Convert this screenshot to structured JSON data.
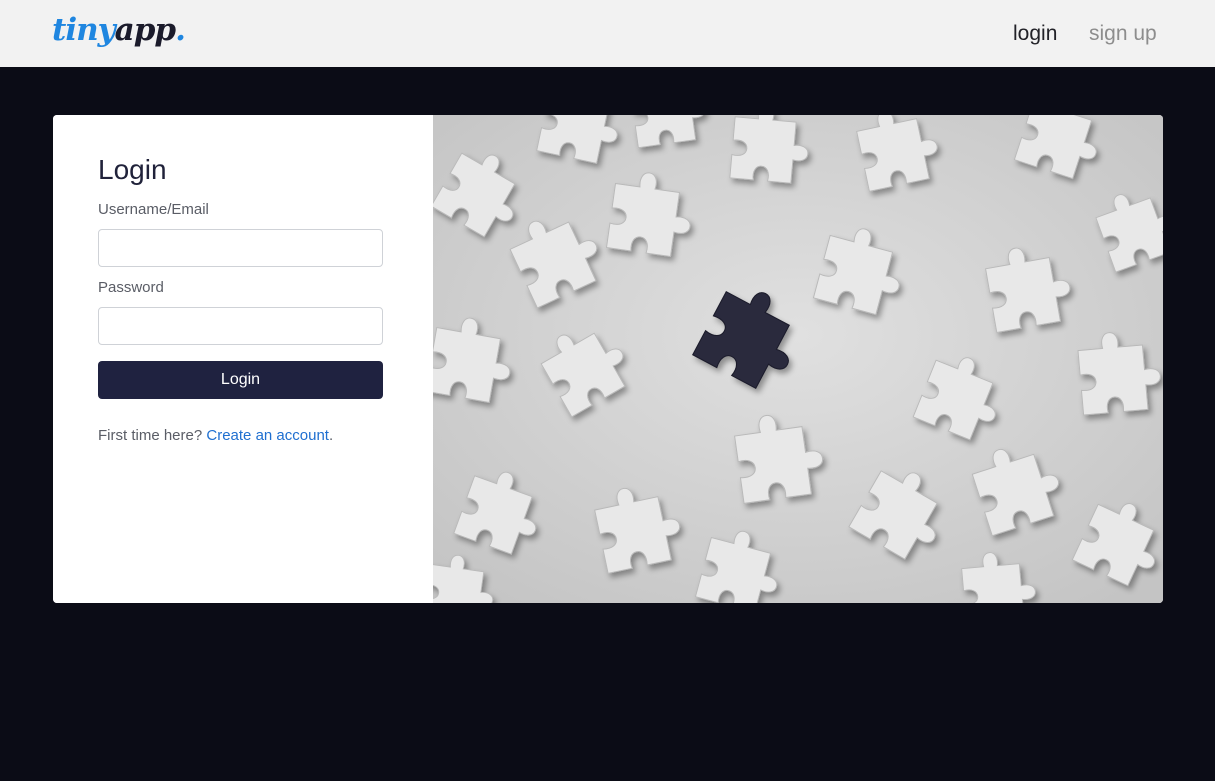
{
  "navbar": {
    "brand": {
      "part1": "tiny",
      "part2": "app",
      "part3": "."
    },
    "links": {
      "login": "login",
      "signup": "sign up"
    }
  },
  "login_form": {
    "title": "Login",
    "username_label": "Username/Email",
    "username_value": "",
    "password_label": "Password",
    "password_value": "",
    "submit_label": "Login",
    "first_time_text": "First time here? ",
    "create_account_link": "Create an account",
    "trailing_period": "."
  },
  "image": {
    "description_icon": "puzzle-pieces-image",
    "colors": {
      "background": "#d4d4d4",
      "piece": "#e9e9e9",
      "highlight_piece": "#2a2a3e"
    }
  },
  "colors": {
    "page_bg": "#0b0c16",
    "navbar_bg": "#f2f2f2",
    "brand_blue": "#1f86e0",
    "button_bg": "#1f2240",
    "link_blue": "#1f6fd0"
  }
}
